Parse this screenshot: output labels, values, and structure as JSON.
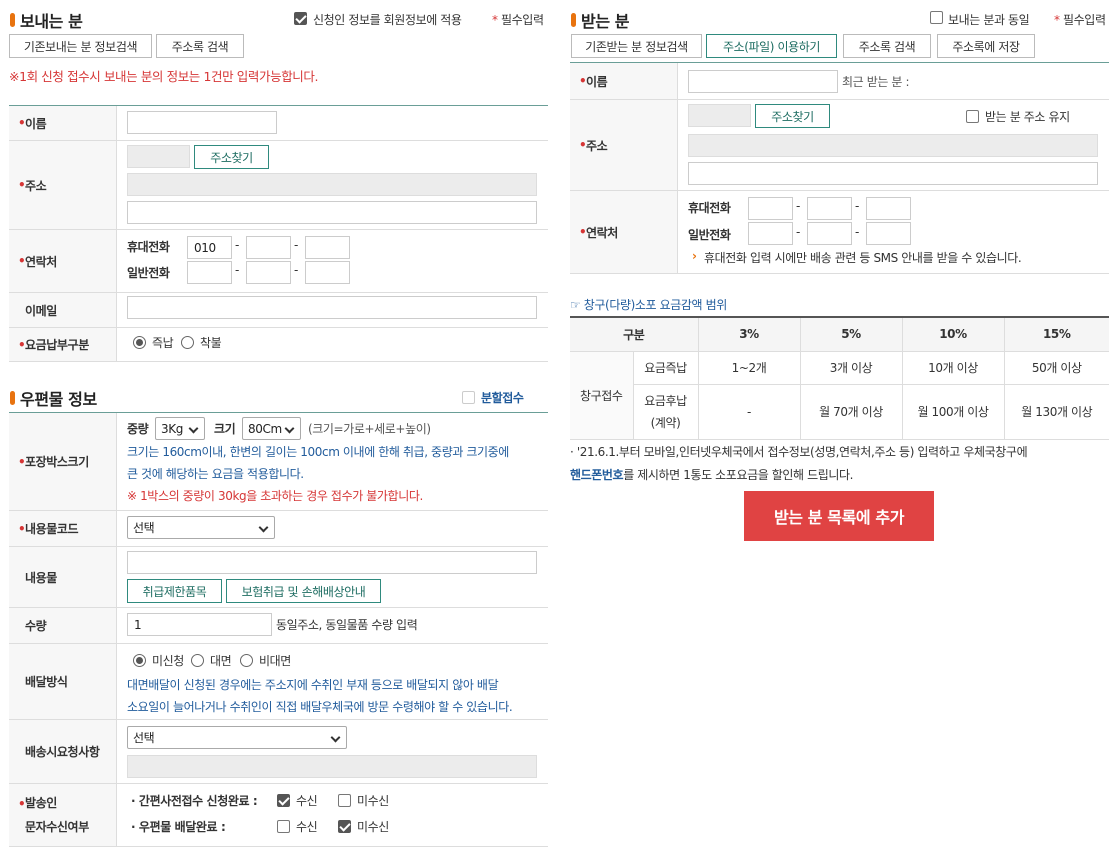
{
  "sender": {
    "title": "보내는 분",
    "save_member_label": "신청인 정보를 회원정보에 적용",
    "required_label": "필수입력",
    "required_mark": "*",
    "btn_existing": "기존보내는 분 정보검색",
    "btn_addressbook": "주소록 검색",
    "notice": "※1회 신청 접수시 보내는 분의 정보는 1건만 입력가능합니다.",
    "name_label": "이름",
    "address_label": "주소",
    "find_address": "주소찾기",
    "contact_label": "연락처",
    "mobile_label": "휴대전화",
    "mobile_prefix": "010",
    "phone_label": "일반전화",
    "email_label": "이메일",
    "payment_label": "요금납부구분",
    "pay_now": "즉납",
    "pay_later": "착불",
    "dash": "-"
  },
  "postal": {
    "title": "우편물 정보",
    "split_label": "분할접수",
    "box_label": "포장박스크기",
    "weight_label": "중량",
    "weight_value": "3Kg",
    "size_label": "크기",
    "size_value": "80Cm",
    "size_hint": "(크기=가로+세로+높이)",
    "size_desc1": "크기는 160cm이내, 한변의 길이는 100cm 이내에 한해 취급, 중량과 크기중에",
    "size_desc2": "큰 것에 해당하는 요금을 적용합니다.",
    "size_warning": "※ 1박스의 중량이 30kg을 초과하는 경우 접수가 불가합니다.",
    "code_label": "내용물코드",
    "code_value": "선택",
    "contents_label": "내용물",
    "btn_restricted": "취급제한품목",
    "btn_insurance": "보험취급 및 손해배상안내",
    "qty_label": "수량",
    "qty_value": "1",
    "qty_hint": "동일주소, 동일물품 수량 입력",
    "delivery_label": "배달방식",
    "delivery_opt1": "미신청",
    "delivery_opt2": "대면",
    "delivery_opt3": "비대면",
    "delivery_desc1": "대면배달이 신청된 경우에는 주소지에 수취인 부재 등으로 배달되지 않아 배달",
    "delivery_desc2": "소요일이 늘어나거나 수취인이 직접 배달우체국에 방문 수령해야 할 수 있습니다.",
    "request_label": "배송시요청사항",
    "request_value": "선택",
    "sms_label1": "발송인",
    "sms_label2": "문자수신여부",
    "sms_row1": "· 간편사전접수 신청완료 :",
    "sms_row2": "· 우편물 배달완료 :",
    "receive": "수신",
    "not_receive": "미수신"
  },
  "receiver": {
    "title": "받는 분",
    "same_as_sender": "보내는 분과 동일",
    "required_label": "필수입력",
    "btn_existing": "기존받는 분 정보검색",
    "btn_file": "주소(파일) 이용하기",
    "btn_addressbook": "주소록 검색",
    "btn_save": "주소록에 저장",
    "name_label": "이름",
    "recent_label": "최근 받는 분 :",
    "address_label": "주소",
    "find_address": "주소찾기",
    "keep_address": "받는 분 주소 유지",
    "contact_label": "연락처",
    "mobile_label": "휴대전화",
    "phone_label": "일반전화",
    "sms_notice": "휴대전화 입력 시에만 배송 관련 등 SMS 안내를 받을 수 있습니다."
  },
  "discount": {
    "title": "창구(다량)소포 요금감액 범위",
    "headers": [
      "구분",
      "3%",
      "5%",
      "10%",
      "15%"
    ],
    "group_label": "창구접수",
    "row1_label": "요금즉납",
    "row1_values": [
      "1~2개",
      "3개 이상",
      "10개 이상",
      "50개 이상"
    ],
    "row2_label1": "요금후납",
    "row2_label2": "(계약)",
    "row2_values": [
      "-",
      "월 70개 이상",
      "월 100개 이상",
      "월 130개 이상"
    ],
    "note1": "'21.6.1.부터 모바일,인터넷우체국에서 접수정보(성명,연락처,주소 등) 입력하고 우체국창구에",
    "note2_bold": "핸드폰번호",
    "note2_rest": "를 제시하면 1통도 소포요금을 할인해 드립니다."
  },
  "add_button": "받는 분 목록에 추가",
  "colors": {
    "accent": "#e8730f",
    "required": "#d63636",
    "teal": "#2f8a7e",
    "add_button": "#e04343",
    "link_blue": "#225c9c"
  }
}
